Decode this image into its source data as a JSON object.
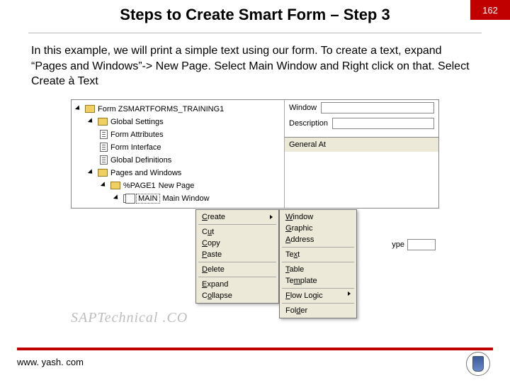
{
  "header": {
    "title": "Steps to Create Smart Form – Step 3",
    "page_number": "162"
  },
  "description": "In this example, we will print a simple text using our form. To create a text, expand “Pages and Windows”-> New Page. Select Main Window and Right click on that. Select Create à Text",
  "tree": {
    "root": "Form ZSMARTFORMS_TRAINING1",
    "global_settings": "Global Settings",
    "form_attributes": "Form Attributes",
    "form_interface": "Form Interface",
    "global_definitions": "Global Definitions",
    "pages_windows": "Pages and Windows",
    "page1_code": "%PAGE1",
    "page1_text": "New Page",
    "main_code": "MAIN",
    "main_text": "Main Window"
  },
  "context_menu": {
    "create": "Create",
    "cut": "Cut",
    "copy": "Copy",
    "paste": "Paste",
    "delete": "Delete",
    "expand": "Expand",
    "collapse": "Collapse"
  },
  "sub_menu": {
    "window": "Window",
    "graphic": "Graphic",
    "address": "Address",
    "text": "Text",
    "table": "Table",
    "template": "Template",
    "flow_logic": "Flow Logic",
    "folder": "Folder"
  },
  "right": {
    "window_label": "Window",
    "description_label": "Description",
    "general_tab": "General At",
    "type_label": "ype"
  },
  "watermark": "SAPTechnical .CO",
  "footer": {
    "url": "www. yash. com"
  }
}
